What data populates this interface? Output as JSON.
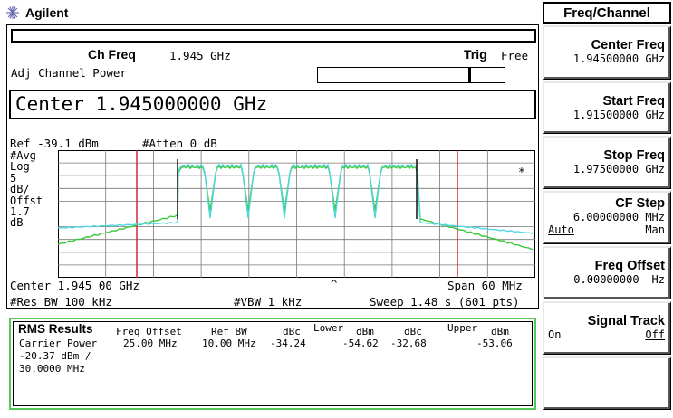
{
  "brand": {
    "label": "Agilent",
    "icon": "agilent-spark-logo-icon"
  },
  "menu": {
    "title": "Freq/Channel"
  },
  "softkeys": {
    "center_freq": {
      "label": "Center Freq",
      "value": "1.94500000 GHz"
    },
    "start_freq": {
      "label": "Start Freq",
      "value": "1.91500000 GHz"
    },
    "stop_freq": {
      "label": "Stop Freq",
      "value": "1.97500000 GHz"
    },
    "cf_step": {
      "label": "CF Step",
      "value": "6.00000000 MHz",
      "opt_auto": "Auto",
      "opt_man": "Man"
    },
    "freq_offset": {
      "label": "Freq Offset",
      "value": "0.00000000",
      "unit": "Hz"
    },
    "signal_track": {
      "label": "Signal Track",
      "opt_on": "On",
      "opt_off": "Off"
    }
  },
  "screen": {
    "ch_freq_label": "Ch Freq",
    "ch_freq_value": "1.945 GHz",
    "trig_label": "Trig",
    "trig_value": "Free",
    "measurement": "Adj Channel Power",
    "center_entry": "Center 1.945000000 GHz",
    "ref_level": "Ref -39.1 dBm",
    "atten": "#Atten 0 dB",
    "scale_lines": [
      "#Avg",
      "Log",
      "5",
      "dB/",
      "Offst",
      "1.7",
      "dB"
    ],
    "marker_symbol": "*",
    "center_readout": "Center 1.945 00 GHz",
    "span_readout": "Span 60 MHz",
    "res_bw": "#Res BW 100 kHz",
    "vbw": "#VBW 1 kHz",
    "sweep": "Sweep 1.48 s (601 pts)",
    "caret": "^"
  },
  "results": {
    "title": "RMS Results",
    "carrier_power_label": "Carrier Power",
    "carrier_power_value": "-20.37 dBm /",
    "carrier_bw": "30.0000 MHz",
    "headers": {
      "freq_offset": "Freq Offset",
      "ref_bw": "Ref BW",
      "dbc1": "dBc",
      "lower": "Lower",
      "dbm1": "dBm",
      "dbc2": "dBc",
      "upper": "Upper",
      "dbm2": "dBm"
    },
    "row": {
      "freq_offset": "25.00 MHz",
      "ref_bw": "10.00 MHz",
      "lower_dbc": "-34.24",
      "lower_dbm": "-54.62",
      "upper_dbc": "-32.68",
      "upper_dbm": "-53.06"
    }
  },
  "colors": {
    "trace_cyan": "#4fd6e0",
    "trace_green": "#3cc83c",
    "marker_red": "#cc2020",
    "results_border": "#58c858",
    "grid": "#777777"
  }
}
